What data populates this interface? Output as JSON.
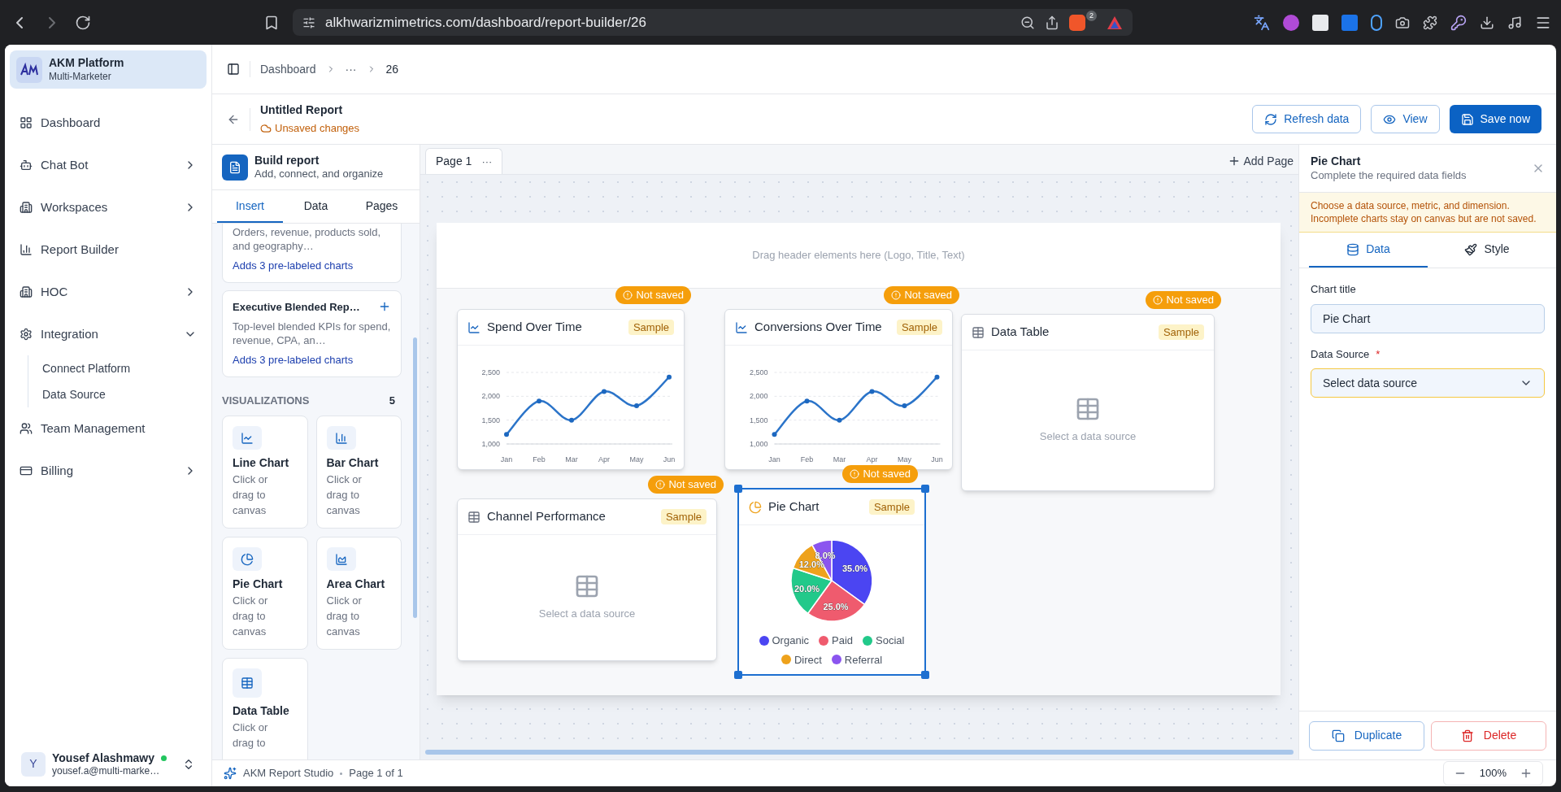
{
  "browser": {
    "url": "alkhwarizmimetrics.com/dashboard/report-builder/26",
    "shield_count": "2"
  },
  "sidebar": {
    "brand": {
      "title": "AKM Platform",
      "subtitle": "Multi-Marketer"
    },
    "items": [
      {
        "label": "Dashboard"
      },
      {
        "label": "Chat Bot",
        "expanded": false
      },
      {
        "label": "Workspaces",
        "expanded": false
      },
      {
        "label": "Report Builder"
      },
      {
        "label": "HOC",
        "expanded": false
      },
      {
        "label": "Integration",
        "expanded": true,
        "children": [
          {
            "label": "Connect Platform"
          },
          {
            "label": "Data Source"
          }
        ]
      },
      {
        "label": "Team Management"
      },
      {
        "label": "Billing",
        "expanded": false
      }
    ],
    "user": {
      "initial": "Y",
      "name": "Yousef Alashmawy",
      "email": "yousef.a@multi-marke…",
      "online": true
    }
  },
  "breadcrumb": [
    "Dashboard",
    "···",
    "26"
  ],
  "report": {
    "title": "Untitled Report",
    "status": "Unsaved changes"
  },
  "actions": [
    {
      "label": "Refresh data",
      "kind": "outline"
    },
    {
      "label": "View",
      "kind": "outline"
    },
    {
      "label": "Save now",
      "kind": "primary"
    }
  ],
  "builder": {
    "title": "Build report",
    "subtitle": "Add, connect, and organize",
    "tabs": [
      {
        "label": "Insert",
        "selected": true
      },
      {
        "label": "Data",
        "selected": false
      },
      {
        "label": "Pages",
        "selected": false
      }
    ],
    "templates": [
      {
        "description": "Orders, revenue, products sold, and geography…",
        "note": "Adds 3 pre-labeled charts"
      },
      {
        "title": "Executive Blended Rep…",
        "description": "Top-level blended KPIs for spend, revenue, CPA, an…",
        "note": "Adds 3 pre-labeled charts"
      }
    ],
    "section": {
      "label": "VISUALIZATIONS",
      "count": "5"
    },
    "visualizations": [
      {
        "label": "Line Chart",
        "hint": "Click or drag to canvas"
      },
      {
        "label": "Bar Chart",
        "hint": "Click or drag to canvas"
      },
      {
        "label": "Pie Chart",
        "hint": "Click or drag to canvas"
      },
      {
        "label": "Area Chart",
        "hint": "Click or drag to canvas"
      },
      {
        "label": "Data Table",
        "hint": "Click or drag to"
      }
    ]
  },
  "canvas": {
    "pages": [
      {
        "label": "Page 1",
        "menu": "···",
        "selected": true
      }
    ],
    "add_page": "Add Page",
    "header_hint": "Drag header elements here (Logo, Title, Text)",
    "widgets": [
      {
        "kind": "line",
        "title": "Spend Over Time",
        "tag": "Sample",
        "status": "Not saved",
        "selected": false,
        "chart_data": {
          "type": "line",
          "categories": [
            "Jan",
            "Feb",
            "Mar",
            "Apr",
            "May",
            "Jun"
          ],
          "series": [
            {
              "values": [
                1200,
                1900,
                1500,
                2100,
                1800,
                2400
              ],
              "marker": true
            }
          ],
          "ylim": [
            1000,
            2500
          ],
          "yticks": [
            {
              "value": 1000,
              "label": "1,000"
            },
            {
              "value": 1500,
              "label": "1,500"
            },
            {
              "value": 2000,
              "label": "2,000"
            },
            {
              "value": 2500,
              "label": "2,500"
            }
          ]
        }
      },
      {
        "kind": "line",
        "title": "Conversions Over Time",
        "tag": "Sample",
        "status": "Not saved",
        "selected": false,
        "chart_data": {
          "type": "line",
          "categories": [
            "Jan",
            "Feb",
            "Mar",
            "Apr",
            "May",
            "Jun"
          ],
          "series": [
            {
              "values": [
                1200,
                1900,
                1500,
                2100,
                1800,
                2400
              ],
              "marker": true
            }
          ],
          "ylim": [
            1000,
            2500
          ],
          "yticks": [
            {
              "value": 1000,
              "label": "1,000"
            },
            {
              "value": 1500,
              "label": "1,500"
            },
            {
              "value": 2000,
              "label": "2,000"
            },
            {
              "value": 2500,
              "label": "2,500"
            }
          ]
        }
      },
      {
        "kind": "table",
        "title": "Data Table",
        "tag": "Sample",
        "status": "Not saved",
        "selected": false,
        "empty_text": "Select a data source"
      },
      {
        "kind": "table",
        "title": "Channel Performance",
        "tag": "Sample",
        "status": "Not saved",
        "selected": false,
        "empty_text": "Select a data source"
      },
      {
        "kind": "pie",
        "title": "Pie Chart",
        "tag": "Sample",
        "status": "Not saved",
        "selected": true,
        "chart_data": {
          "type": "pie",
          "categories": [
            "Organic",
            "Paid",
            "Social",
            "Direct",
            "Referral"
          ],
          "series": [
            {
              "values": [
                35,
                25,
                20,
                12,
                8
              ]
            }
          ],
          "value_labels": [
            "35.0%",
            "25.0%",
            "20.0%",
            "12.0%",
            "8.0%"
          ]
        },
        "legend": [
          {
            "color": "#4b45f2"
          },
          {
            "color": "#ef5b6e"
          },
          {
            "color": "#22c98a"
          },
          {
            "color": "#eea21c"
          },
          {
            "color": "#8b55ef"
          }
        ]
      }
    ]
  },
  "inspector": {
    "title": "Pie Chart",
    "subtitle": "Complete the required data fields",
    "warning": "Choose a data source, metric, and dimension. Incomplete charts stay on canvas but are not saved.",
    "tabs": [
      {
        "label": "Data",
        "selected": true
      },
      {
        "label": "Style",
        "selected": false
      }
    ],
    "fields": [
      {
        "kind": "text",
        "label": "Chart title",
        "value": "Pie Chart"
      },
      {
        "kind": "select",
        "label": "Data Source",
        "placeholder": "Select data source",
        "required_mark": "*"
      }
    ],
    "buttons": [
      {
        "label": "Duplicate",
        "kind": "neutral"
      },
      {
        "label": "Delete",
        "kind": "danger"
      }
    ]
  },
  "footer": {
    "brand": "AKM Report Studio",
    "page_info": "Page 1 of 1",
    "zoom": "100%"
  }
}
